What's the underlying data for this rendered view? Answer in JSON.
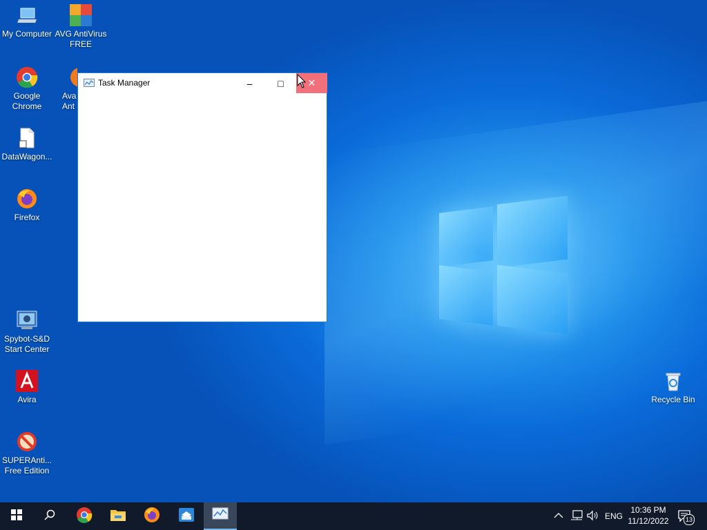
{
  "desktop": {
    "icons": [
      {
        "label": "My Computer",
        "icon": "computer-icon"
      },
      {
        "label": "AVG AntiVirus FREE",
        "icon": "avg-icon"
      },
      {
        "label": "Google Chrome",
        "icon": "chrome-icon"
      },
      {
        "label": "Ava Ant",
        "icon": "avast-icon"
      },
      {
        "label": "DataWagon...",
        "icon": "document-icon"
      },
      {
        "label": "Firefox",
        "icon": "firefox-icon"
      },
      {
        "label": "Spybot-S&D Start Center",
        "icon": "spybot-icon"
      },
      {
        "label": "Avira",
        "icon": "avira-icon"
      },
      {
        "label": "SUPERAnti... Free Edition",
        "icon": "superantispyware-icon"
      },
      {
        "label": "Recycle Bin",
        "icon": "recycle-bin-icon"
      }
    ]
  },
  "window": {
    "title": "Task Manager",
    "minimize": "–",
    "maximize": "□",
    "close": "✕",
    "close_hover_color": "#f1707a"
  },
  "taskbar": {
    "start_icon": "windows-start-icon",
    "search_icon": "search-icon",
    "pinned": [
      "chrome-icon",
      "file-explorer-icon",
      "firefox-icon",
      "sandbox-icon",
      "task-manager-icon"
    ],
    "tray": {
      "language": "ENG",
      "time": "10:36 PM",
      "date": "11/12/2022",
      "notification_count": "13"
    }
  }
}
